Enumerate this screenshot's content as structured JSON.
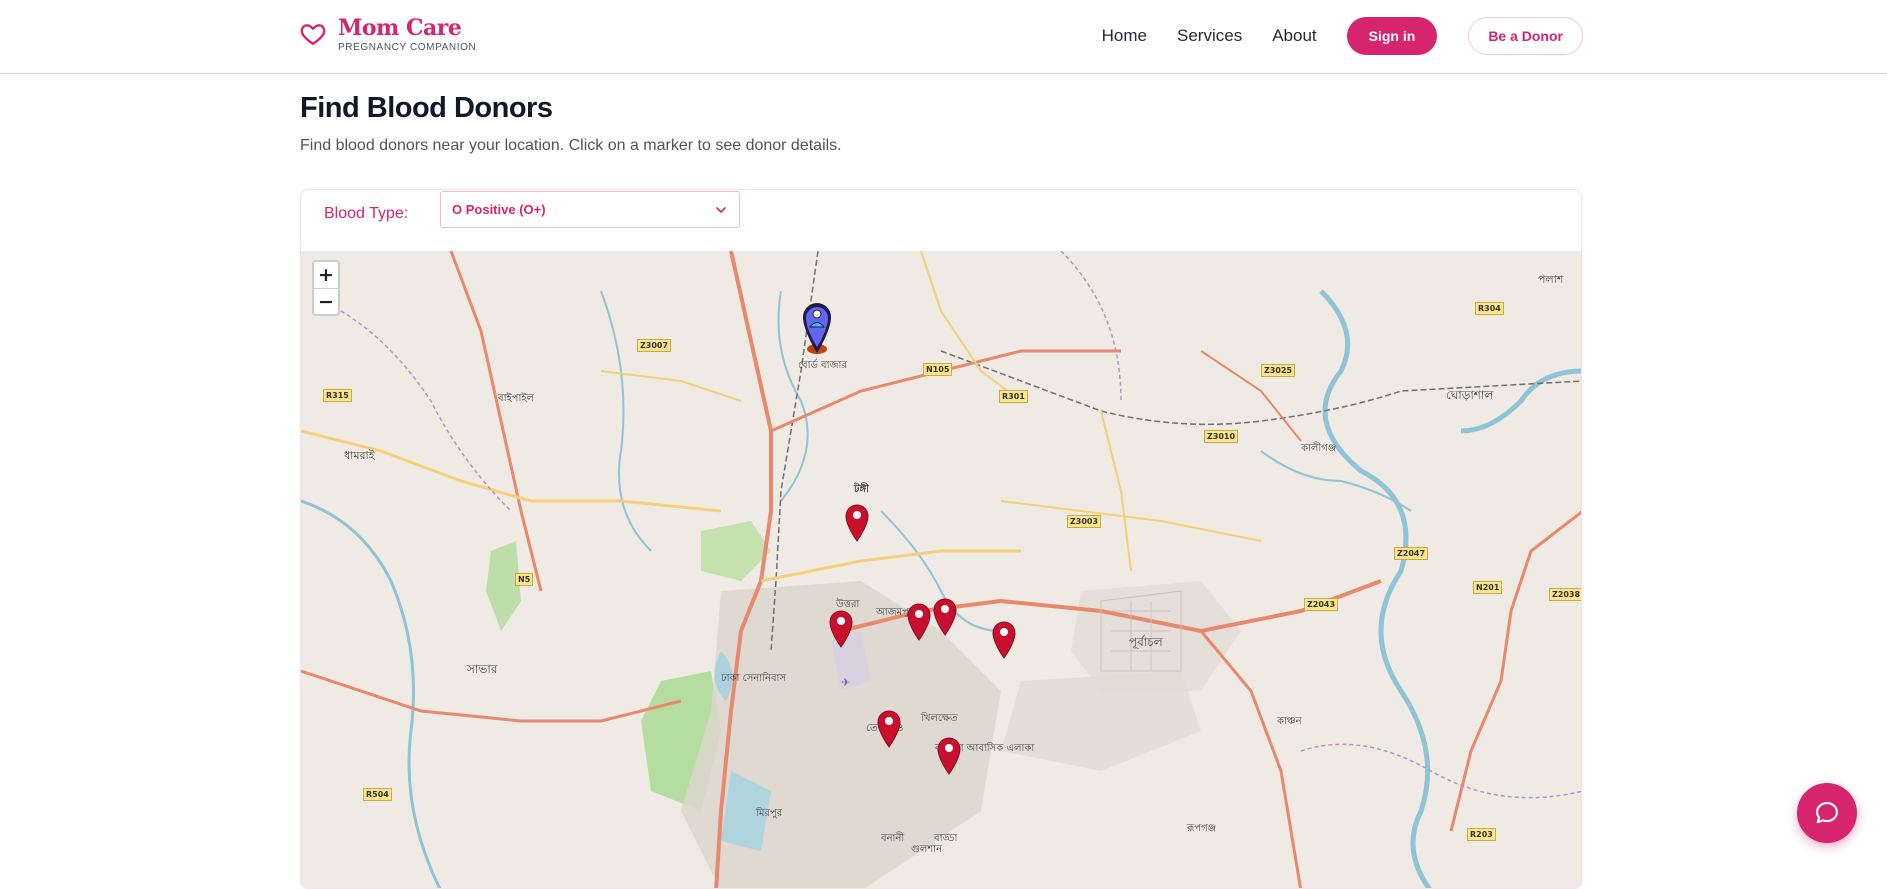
{
  "header": {
    "brand_name": "Mom Care",
    "brand_tagline": "PREGNANCY COMPANION",
    "nav": [
      "Home",
      "Services",
      "About"
    ],
    "signin_label": "Sign in",
    "donor_label": "Be a Donor"
  },
  "page": {
    "title": "Find Blood Donors",
    "subtitle": "Find blood donors near your location. Click on a marker to see donor details."
  },
  "filter": {
    "label": "Blood Type:",
    "selected": "O Positive (O+)"
  },
  "map": {
    "zoom_in": "+",
    "zoom_out": "−",
    "place_labels": {
      "board_bazar": "বোর্ড বাজার",
      "tongi": "টঙ্গী",
      "uttara": "উত্তরা",
      "ajampur": "আজমপুর",
      "savar": "সাভার",
      "purbachal": "পূর্বাচল",
      "kalukganj": "কালীগঞ্জ",
      "ghorashal": "ঘোড়াশাল",
      "palash": "পলাশ",
      "dhamrai": "ধামরাই",
      "baipail": "বাইপাইল",
      "mirpur": "মিরপুর",
      "dhaka_cantonment": "ঢাকা সেনানিবাস",
      "badda": "বাড্ডা",
      "gulshan": "গুলশান",
      "banani": "বনানী",
      "rupganj": "রূপগঞ্জ",
      "kanchan": "কাঞ্চন",
      "tejgaon": "তেজগাঁও",
      "khilkhet": "খিলক্ষেত",
      "bashundhara": "বসুন্ধরা আবাসিক এলাকা"
    },
    "road_shields": [
      "Z3007",
      "N105",
      "R301",
      "Z3025",
      "R304",
      "R315",
      "Z3010",
      "Z3003",
      "Z2047",
      "N5",
      "Z2043",
      "N201",
      "Z2038",
      "R504",
      "R203"
    ],
    "user_marker": "user-location",
    "donor_count": 7,
    "accent_color": "#d6246e",
    "marker_color": "#c8102e"
  },
  "chat_fab_icon": "chat-bubble-icon"
}
